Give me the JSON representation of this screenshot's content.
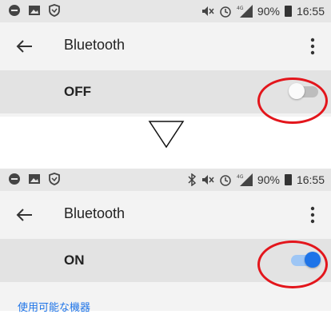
{
  "before": {
    "status": {
      "battery": "90%",
      "time": "16:55"
    },
    "toolbar": {
      "title": "Bluetooth"
    },
    "toggle": {
      "label": "OFF",
      "state": "off"
    }
  },
  "after": {
    "status": {
      "battery": "90%",
      "time": "16:55"
    },
    "toolbar": {
      "title": "Bluetooth"
    },
    "toggle": {
      "label": "ON",
      "state": "on"
    },
    "section_header": "使用可能な機器"
  },
  "colors": {
    "accent": "#1e74e8",
    "annotation": "#e3161c"
  }
}
